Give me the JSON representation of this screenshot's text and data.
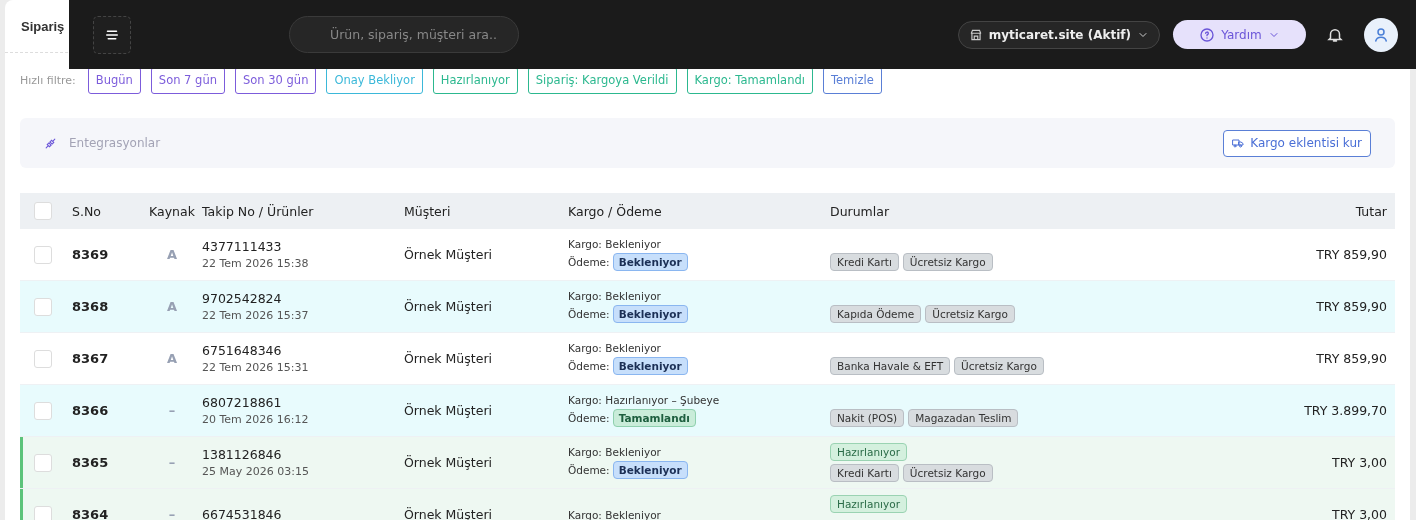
{
  "page": {
    "title": "Sipariş"
  },
  "topbar": {
    "search": {
      "placeholder": "Ürün, sipariş, müşteri ara.."
    },
    "store": "myticaret.site (Aktif)",
    "help": "Yardım"
  },
  "quick_filter": {
    "label": "Hızlı filtre:",
    "chips": [
      {
        "label": "Bugün",
        "color": "#7c5cdb"
      },
      {
        "label": "Son 7 gün",
        "color": "#7c5cdb"
      },
      {
        "label": "Son 30 gün",
        "color": "#7c5cdb"
      },
      {
        "label": "Onay Bekliyor",
        "color": "#3bb8d9"
      },
      {
        "label": "Hazırlanıyor",
        "color": "#2cb88f"
      },
      {
        "label": "Sipariş: Kargoya Verildi",
        "color": "#2cb88f"
      },
      {
        "label": "Kargo: Tamamlandı",
        "color": "#2cb88f"
      },
      {
        "label": "Temizle",
        "color": "#5a7fd6"
      }
    ]
  },
  "integrations": {
    "label": "Entegrasyonlar",
    "button": "Kargo eklentisi kur"
  },
  "table": {
    "select_all": {
      "checked": false
    },
    "columns": [
      "S.No",
      "Kaynak",
      "Takip No / Ürünler",
      "Müşteri",
      "Kargo / Ödeme",
      "Durumlar",
      "Tutar"
    ],
    "rows": [
      {
        "kind": "plain",
        "checked": false,
        "sno": "8369",
        "source": "A",
        "tracking": "4377111433",
        "date": "22 Tem 2026 15:38",
        "customer": "Örnek Müşteri",
        "cargo": "Kargo: Bekleniyor",
        "payment_label": "Ödeme:",
        "payment": {
          "label": "Bekleniyor",
          "kind": "pending"
        },
        "statuses": [
          [
            {
              "label": "Kredi Kartı",
              "kind": "tag"
            },
            {
              "label": "Ücretsiz Kargo",
              "kind": "tag"
            }
          ]
        ],
        "amount": "TRY 859,90"
      },
      {
        "kind": "alt",
        "checked": false,
        "sno": "8368",
        "source": "A",
        "tracking": "9702542824",
        "date": "22 Tem 2026 15:37",
        "customer": "Örnek Müşteri",
        "cargo": "Kargo: Bekleniyor",
        "payment_label": "Ödeme:",
        "payment": {
          "label": "Bekleniyor",
          "kind": "pending"
        },
        "statuses": [
          [
            {
              "label": "Kapıda Ödeme",
              "kind": "tag"
            },
            {
              "label": "Ücretsiz Kargo",
              "kind": "tag"
            }
          ]
        ],
        "amount": "TRY 859,90"
      },
      {
        "kind": "plain",
        "checked": false,
        "sno": "8367",
        "source": "A",
        "tracking": "6751648346",
        "date": "22 Tem 2026 15:31",
        "customer": "Örnek Müşteri",
        "cargo": "Kargo: Bekleniyor",
        "payment_label": "Ödeme:",
        "payment": {
          "label": "Bekleniyor",
          "kind": "pending"
        },
        "statuses": [
          [
            {
              "label": "Banka Havale & EFT",
              "kind": "tag"
            },
            {
              "label": "Ücretsiz Kargo",
              "kind": "tag"
            }
          ]
        ],
        "amount": "TRY 859,90"
      },
      {
        "kind": "alt",
        "checked": false,
        "sno": "8366",
        "source": "–",
        "tracking": "6807218861",
        "date": "20 Tem 2026 16:12",
        "customer": "Örnek Müşteri",
        "cargo": "Kargo: Hazırlanıyor – Şubeye",
        "payment_label": "Ödeme:",
        "payment": {
          "label": "Tamamlandı",
          "kind": "done"
        },
        "statuses": [
          [
            {
              "label": "Nakit (POS)",
              "kind": "tag"
            },
            {
              "label": "Magazadan Teslim",
              "kind": "tag"
            }
          ]
        ],
        "amount": "TRY 3.899,70"
      },
      {
        "kind": "preparing",
        "checked": false,
        "sno": "8365",
        "source": "–",
        "tracking": "1381126846",
        "date": "25 May 2026 03:15",
        "customer": "Örnek Müşteri",
        "cargo": "Kargo: Bekleniyor",
        "payment_label": "Ödeme:",
        "payment": {
          "label": "Bekleniyor",
          "kind": "pending"
        },
        "statuses": [
          [
            {
              "label": "Hazırlanıyor",
              "kind": "status"
            }
          ],
          [
            {
              "label": "Kredi Kartı",
              "kind": "tag"
            },
            {
              "label": "Ücretsiz Kargo",
              "kind": "tag"
            }
          ]
        ],
        "amount": "TRY 3,00"
      },
      {
        "kind": "preparing",
        "checked": false,
        "sno": "8364",
        "source": "–",
        "tracking": "6674531846",
        "customer": "Örnek Müşteri",
        "cargo": "Kargo: Bekleniyor",
        "statuses": [
          [
            {
              "label": "Hazırlanıyor",
              "kind": "status"
            }
          ]
        ],
        "amount": "TRY 3,00"
      }
    ]
  }
}
